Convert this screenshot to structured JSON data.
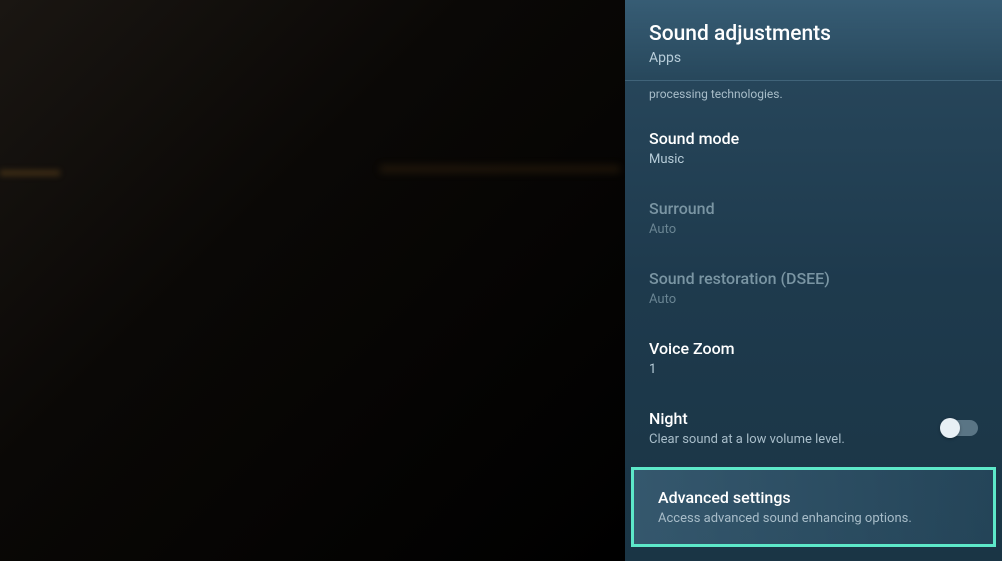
{
  "panel": {
    "title": "Sound adjustments",
    "subtitle": "Apps"
  },
  "truncated": "processing technologies.",
  "items": {
    "soundMode": {
      "label": "Sound mode",
      "value": "Music"
    },
    "surround": {
      "label": "Surround",
      "value": "Auto"
    },
    "soundRestoration": {
      "label": "Sound restoration (DSEE)",
      "value": "Auto"
    },
    "voiceZoom": {
      "label": "Voice Zoom",
      "value": "1"
    },
    "night": {
      "label": "Night",
      "description": "Clear sound at a low volume level."
    },
    "advanced": {
      "label": "Advanced settings",
      "description": "Access advanced sound enhancing options."
    }
  }
}
